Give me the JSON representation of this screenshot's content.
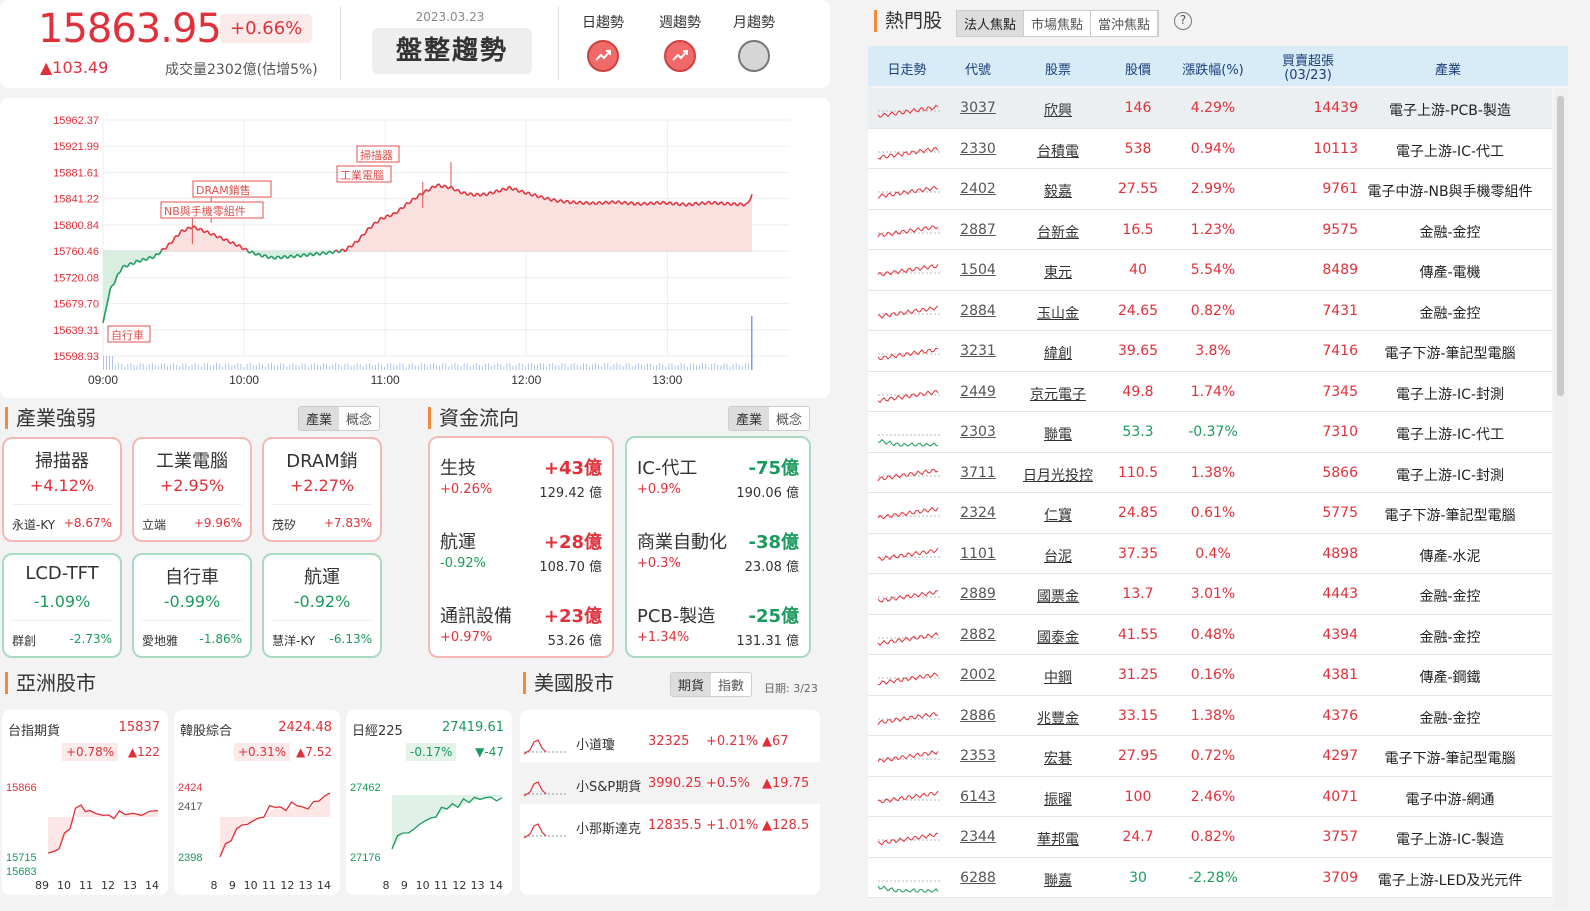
{
  "header": {
    "index_value": "15863.95",
    "index_pct": "+0.66%",
    "index_change": "▲103.49",
    "volume": "成交量2302億(估增5%)",
    "date": "2023.03.23",
    "trend_label": "盤整趨勢",
    "trend_tabs": [
      {
        "label": "日趨勢",
        "state": "up"
      },
      {
        "label": "週趨勢",
        "state": "up"
      },
      {
        "label": "月趨勢",
        "state": "neutral"
      }
    ]
  },
  "chart_data": {
    "type": "line",
    "title": "",
    "y_ticks": [
      "15962.37",
      "15921.99",
      "15881.61",
      "15841.22",
      "15800.84",
      "15760.46",
      "15720.08",
      "15679.70",
      "15639.31",
      "15598.93"
    ],
    "x_ticks": [
      "09:00",
      "10:00",
      "11:00",
      "12:00",
      "13:00"
    ],
    "reference": 15760.46,
    "ylim": [
      15598.93,
      15962.37
    ],
    "points": [
      [
        0,
        15650
      ],
      [
        3,
        15700
      ],
      [
        8,
        15735
      ],
      [
        15,
        15745
      ],
      [
        22,
        15752
      ],
      [
        28,
        15770
      ],
      [
        33,
        15790
      ],
      [
        38,
        15798
      ],
      [
        44,
        15790
      ],
      [
        52,
        15778
      ],
      [
        58,
        15768
      ],
      [
        62,
        15760
      ],
      [
        66,
        15755
      ],
      [
        72,
        15750
      ],
      [
        80,
        15752
      ],
      [
        88,
        15755
      ],
      [
        96,
        15758
      ],
      [
        103,
        15762
      ],
      [
        108,
        15775
      ],
      [
        113,
        15795
      ],
      [
        118,
        15810
      ],
      [
        124,
        15818
      ],
      [
        130,
        15835
      ],
      [
        136,
        15850
      ],
      [
        142,
        15862
      ],
      [
        148,
        15858
      ],
      [
        153,
        15850
      ],
      [
        158,
        15847
      ],
      [
        163,
        15848
      ],
      [
        168,
        15853
      ],
      [
        173,
        15858
      ],
      [
        178,
        15852
      ],
      [
        183,
        15847
      ],
      [
        188,
        15842
      ],
      [
        193,
        15838
      ],
      [
        198,
        15836
      ],
      [
        208,
        15834
      ],
      [
        218,
        15836
      ],
      [
        228,
        15833
      ],
      [
        238,
        15835
      ],
      [
        248,
        15832
      ],
      [
        258,
        15835
      ],
      [
        268,
        15833
      ],
      [
        274,
        15832
      ],
      [
        276,
        15848
      ]
    ],
    "annotations": [
      "掃描器",
      "工業電腦",
      "DRAM銷售",
      "NB與手機零組件",
      "自行車"
    ]
  },
  "industry_strength": {
    "title": "產業強弱",
    "tabs": [
      "產業",
      "概念"
    ],
    "cards": [
      {
        "name": "掃描器",
        "pct": "+4.12%",
        "stock": "永道-KY",
        "stock_pct": "+8.67%",
        "dir": "up"
      },
      {
        "name": "工業電腦",
        "pct": "+2.95%",
        "stock": "立端",
        "stock_pct": "+9.96%",
        "dir": "up"
      },
      {
        "name": "DRAM銷",
        "pct": "+2.27%",
        "stock": "茂矽",
        "stock_pct": "+7.83%",
        "dir": "up"
      },
      {
        "name": "LCD-TFT",
        "pct": "-1.09%",
        "stock": "群創",
        "stock_pct": "-2.73%",
        "dir": "down"
      },
      {
        "name": "自行車",
        "pct": "-0.99%",
        "stock": "愛地雅",
        "stock_pct": "-1.86%",
        "dir": "down"
      },
      {
        "name": "航運",
        "pct": "-0.92%",
        "stock": "慧洋-KY",
        "stock_pct": "-6.13%",
        "dir": "down"
      }
    ]
  },
  "fund_flow": {
    "title": "資金流向",
    "tabs": [
      "產業",
      "概念"
    ],
    "inflow": [
      {
        "name": "生技",
        "amount": "+43億",
        "pct": "+0.26%",
        "vol": "129.42 億",
        "dir": "up"
      },
      {
        "name": "航運",
        "amount": "+28億",
        "pct": "-0.92%",
        "vol": "108.70 億",
        "dir": "down"
      },
      {
        "name": "通訊設備",
        "amount": "+23億",
        "pct": "+0.97%",
        "vol": "53.26 億",
        "dir": "up"
      }
    ],
    "outflow": [
      {
        "name": "IC-代工",
        "amount": "-75億",
        "pct": "+0.9%",
        "vol": "190.06 億",
        "dir": "up"
      },
      {
        "name": "商業自動化",
        "amount": "-38億",
        "pct": "+0.3%",
        "vol": "23.08 億",
        "dir": "up"
      },
      {
        "name": "PCB-製造",
        "amount": "-25億",
        "pct": "+1.34%",
        "vol": "131.31 億",
        "dir": "up"
      }
    ]
  },
  "asia": {
    "title": "亞洲股市",
    "cards": [
      {
        "name": "台指期貨",
        "value": "15837",
        "pct": "+0.78%",
        "chg": "▲122",
        "hi": "15866",
        "lo": "15715",
        "lo2": "15683",
        "ticks": [
          "89",
          "10",
          "11",
          "12",
          "13",
          "14"
        ],
        "dir": "up"
      },
      {
        "name": "韓股綜合",
        "value": "2424.48",
        "pct": "+0.31%",
        "chg": "▲7.52",
        "hi": "2424",
        "mid": "2417",
        "lo": "2398",
        "ticks": [
          "8",
          "9",
          "10",
          "11",
          "12",
          "13",
          "14"
        ],
        "dir": "up"
      },
      {
        "name": "日經225",
        "value": "27419.61",
        "pct": "-0.17%",
        "chg": "▼-47",
        "hi": "27462",
        "lo": "27176",
        "ticks": [
          "8",
          "9",
          "10",
          "11",
          "12",
          "13",
          "14"
        ],
        "dir": "down"
      }
    ]
  },
  "us": {
    "title": "美國股市",
    "tabs": [
      "期貨",
      "指數"
    ],
    "date": "日期: 3/23",
    "rows": [
      {
        "name": "小道瓊",
        "value": "32325",
        "pct": "+0.21%",
        "chg": "▲67"
      },
      {
        "name": "小S&P期貨",
        "value": "3990.25",
        "pct": "+0.5%",
        "chg": "▲19.75"
      },
      {
        "name": "小那斯達克",
        "value": "12835.5",
        "pct": "+1.01%",
        "chg": "▲128.5"
      }
    ]
  },
  "hot": {
    "title": "熱門股",
    "tabs": [
      "法人焦點",
      "市場焦點",
      "當沖焦點"
    ],
    "help": "?",
    "headers": [
      "日走勢",
      "代號",
      "股票",
      "股價",
      "漲跌幅(%)",
      "買賣超張",
      "(03/23)",
      "產業"
    ],
    "rows": [
      {
        "code": "3037",
        "name": "欣興",
        "price": "146",
        "pct": "4.29%",
        "vol": "14439",
        "ind": "電子上游-PCB-製造",
        "dir": "up"
      },
      {
        "code": "2330",
        "name": "台積電",
        "price": "538",
        "pct": "0.94%",
        "vol": "10113",
        "ind": "電子上游-IC-代工",
        "dir": "up"
      },
      {
        "code": "2402",
        "name": "毅嘉",
        "price": "27.55",
        "pct": "2.99%",
        "vol": "9761",
        "ind": "電子中游-NB與手機零組件",
        "dir": "up"
      },
      {
        "code": "2887",
        "name": "台新金",
        "price": "16.5",
        "pct": "1.23%",
        "vol": "9575",
        "ind": "金融-金控",
        "dir": "up"
      },
      {
        "code": "1504",
        "name": "東元",
        "price": "40",
        "pct": "5.54%",
        "vol": "8489",
        "ind": "傳產-電機",
        "dir": "up"
      },
      {
        "code": "2884",
        "name": "玉山金",
        "price": "24.65",
        "pct": "0.82%",
        "vol": "7431",
        "ind": "金融-金控",
        "dir": "up"
      },
      {
        "code": "3231",
        "name": "緯創",
        "price": "39.65",
        "pct": "3.8%",
        "vol": "7416",
        "ind": "電子下游-筆記型電腦",
        "dir": "up"
      },
      {
        "code": "2449",
        "name": "京元電子",
        "price": "49.8",
        "pct": "1.74%",
        "vol": "7345",
        "ind": "電子上游-IC-封測",
        "dir": "up"
      },
      {
        "code": "2303",
        "name": "聯電",
        "price": "53.3",
        "pct": "-0.37%",
        "vol": "7310",
        "ind": "電子上游-IC-代工",
        "dir": "down"
      },
      {
        "code": "3711",
        "name": "日月光投控",
        "price": "110.5",
        "pct": "1.38%",
        "vol": "5866",
        "ind": "電子上游-IC-封測",
        "dir": "up"
      },
      {
        "code": "2324",
        "name": "仁寶",
        "price": "24.85",
        "pct": "0.61%",
        "vol": "5775",
        "ind": "電子下游-筆記型電腦",
        "dir": "up"
      },
      {
        "code": "1101",
        "name": "台泥",
        "price": "37.35",
        "pct": "0.4%",
        "vol": "4898",
        "ind": "傳產-水泥",
        "dir": "up"
      },
      {
        "code": "2889",
        "name": "國票金",
        "price": "13.7",
        "pct": "3.01%",
        "vol": "4443",
        "ind": "金融-金控",
        "dir": "up"
      },
      {
        "code": "2882",
        "name": "國泰金",
        "price": "41.55",
        "pct": "0.48%",
        "vol": "4394",
        "ind": "金融-金控",
        "dir": "up"
      },
      {
        "code": "2002",
        "name": "中鋼",
        "price": "31.25",
        "pct": "0.16%",
        "vol": "4381",
        "ind": "傳產-鋼鐵",
        "dir": "up"
      },
      {
        "code": "2886",
        "name": "兆豐金",
        "price": "33.15",
        "pct": "1.38%",
        "vol": "4376",
        "ind": "金融-金控",
        "dir": "up"
      },
      {
        "code": "2353",
        "name": "宏碁",
        "price": "27.95",
        "pct": "0.72%",
        "vol": "4297",
        "ind": "電子下游-筆記型電腦",
        "dir": "up"
      },
      {
        "code": "6143",
        "name": "振曜",
        "price": "100",
        "pct": "2.46%",
        "vol": "4071",
        "ind": "電子中游-網通",
        "dir": "up"
      },
      {
        "code": "2344",
        "name": "華邦電",
        "price": "24.7",
        "pct": "0.82%",
        "vol": "3757",
        "ind": "電子上游-IC-製造",
        "dir": "up"
      },
      {
        "code": "6288",
        "name": "聯嘉",
        "price": "30",
        "pct": "-2.28%",
        "vol": "3709",
        "ind": "電子上游-LED及光元件",
        "dir": "down"
      }
    ]
  },
  "colors": {
    "up": "#e0303a",
    "down": "#1a9a5c",
    "accent": "#f08a3c"
  }
}
